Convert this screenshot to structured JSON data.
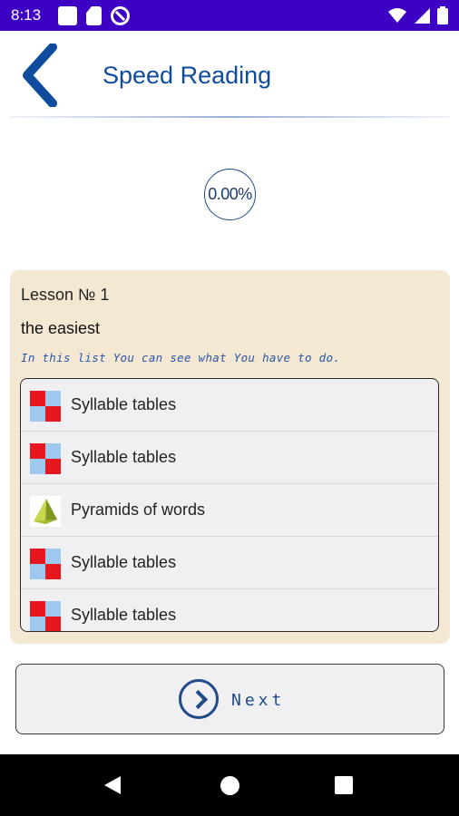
{
  "status_bar": {
    "time": "8:13",
    "left_icons": [
      "square-notification-icon",
      "sd-card-icon",
      "do-not-disturb-icon"
    ],
    "right_icons": [
      "wifi-icon",
      "signal-icon",
      "battery-icon"
    ]
  },
  "header": {
    "title": "Speed Reading",
    "back_icon": "chevron-left-icon"
  },
  "progress": {
    "text": "0.00%",
    "value": 0.0
  },
  "lesson": {
    "number": "Lesson № 1",
    "subtitle": "the easiest",
    "instruction": "In this list You can see what You have to do.",
    "exercises": [
      {
        "label": "Syllable tables",
        "icon": "syllable-table-icon"
      },
      {
        "label": "Syllable tables",
        "icon": "syllable-table-icon"
      },
      {
        "label": "Pyramids of words",
        "icon": "pyramid-icon"
      },
      {
        "label": "Syllable tables",
        "icon": "syllable-table-icon"
      },
      {
        "label": "Syllable tables",
        "icon": "syllable-table-icon"
      }
    ]
  },
  "next_button": {
    "label": "Next",
    "icon": "chevron-right-circle-icon"
  },
  "colors": {
    "status_bar": "#3e00c2",
    "title": "#0f4c9e",
    "card_background": "#f5e8d2",
    "accent": "#1f4a8a"
  }
}
